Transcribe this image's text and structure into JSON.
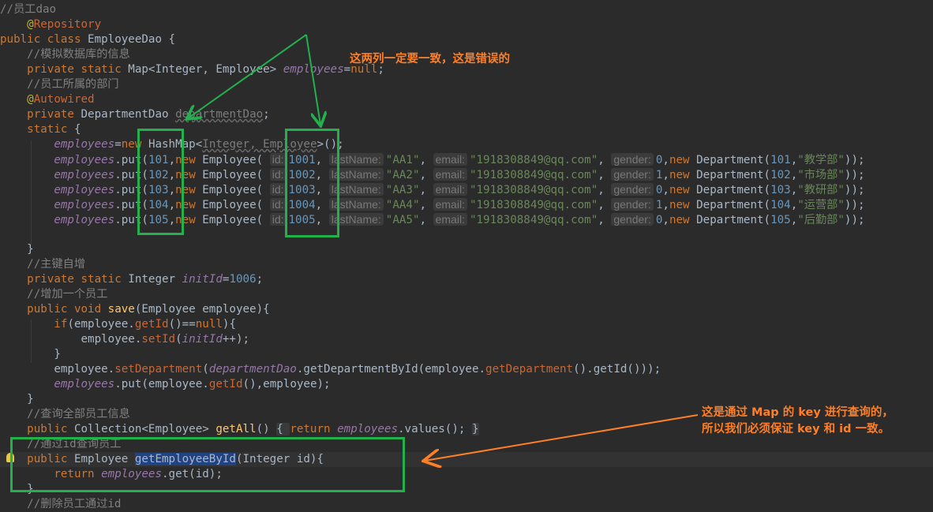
{
  "editor": {
    "lines": [
      [
        {
          "c": "cm",
          "t": "//员工dao"
        }
      ],
      [
        {
          "c": "",
          "t": "    "
        },
        {
          "c": "ann",
          "t": "@"
        },
        {
          "c": "annn",
          "t": "Repository"
        }
      ],
      [
        {
          "c": "kw",
          "t": "public class "
        },
        {
          "c": "",
          "t": "EmployeeDao {"
        }
      ],
      [
        {
          "c": "",
          "t": "    "
        },
        {
          "c": "cm",
          "t": "//模拟数据库的信息"
        }
      ],
      [
        {
          "c": "",
          "t": "    "
        },
        {
          "c": "kw",
          "t": "private static "
        },
        {
          "c": "",
          "t": "Map<Integer, Employee> "
        },
        {
          "c": "fld",
          "t": "employees"
        },
        {
          "c": "",
          "t": "="
        },
        {
          "c": "kw",
          "t": "null"
        },
        {
          "c": "",
          "t": ";"
        }
      ],
      [
        {
          "c": "",
          "t": "    "
        },
        {
          "c": "cm",
          "t": "//员工所属的部门"
        }
      ],
      [
        {
          "c": "",
          "t": "    "
        },
        {
          "c": "ann",
          "t": "@"
        },
        {
          "c": "annn",
          "t": "Autowired"
        }
      ],
      [
        {
          "c": "",
          "t": "    "
        },
        {
          "c": "kw",
          "t": "private "
        },
        {
          "c": "",
          "t": "DepartmentDao "
        },
        {
          "c": "unused",
          "t": "departmentDao"
        },
        {
          "c": "",
          "t": ";"
        }
      ],
      [
        {
          "c": "",
          "t": "    "
        },
        {
          "c": "kw",
          "t": "static "
        },
        {
          "c": "",
          "t": "{"
        }
      ],
      [
        {
          "c": "",
          "t": "        "
        },
        {
          "c": "fld",
          "t": "employees"
        },
        {
          "c": "",
          "t": "="
        },
        {
          "c": "kw",
          "t": "new "
        },
        {
          "c": "",
          "t": "HashMap<"
        },
        {
          "c": "unused",
          "t": "Integer, Employee"
        },
        {
          "c": "",
          "t": ">();"
        }
      ],
      [
        {
          "c": "",
          "t": "        "
        },
        {
          "c": "fld",
          "t": "employees"
        },
        {
          "c": "",
          "t": ".put("
        },
        {
          "c": "num",
          "t": "101"
        },
        {
          "c": "",
          "t": ","
        },
        {
          "c": "kw",
          "t": "new "
        },
        {
          "c": "",
          "t": "Employee( "
        },
        {
          "c": "hint",
          "t": "id:"
        },
        {
          "c": "num",
          "t": "1001"
        },
        {
          "c": "",
          "t": ", "
        },
        {
          "c": "hint",
          "t": "lastName:"
        },
        {
          "c": "str",
          "t": "\"AA1\""
        },
        {
          "c": "",
          "t": ", "
        },
        {
          "c": "hint",
          "t": "email:"
        },
        {
          "c": "str",
          "t": "\"1918308849@qq.com\""
        },
        {
          "c": "",
          "t": ", "
        },
        {
          "c": "hint",
          "t": "gender:"
        },
        {
          "c": "num",
          "t": "0"
        },
        {
          "c": "",
          "t": ","
        },
        {
          "c": "kw",
          "t": "new "
        },
        {
          "c": "",
          "t": "Department("
        },
        {
          "c": "num",
          "t": "101"
        },
        {
          "c": "",
          "t": ","
        },
        {
          "c": "str",
          "t": "\"教学部\""
        },
        {
          "c": "",
          "t": "));"
        }
      ],
      [
        {
          "c": "",
          "t": "        "
        },
        {
          "c": "fld",
          "t": "employees"
        },
        {
          "c": "",
          "t": ".put("
        },
        {
          "c": "num",
          "t": "102"
        },
        {
          "c": "",
          "t": ","
        },
        {
          "c": "kw",
          "t": "new "
        },
        {
          "c": "",
          "t": "Employee( "
        },
        {
          "c": "hint",
          "t": "id:"
        },
        {
          "c": "num",
          "t": "1002"
        },
        {
          "c": "",
          "t": ", "
        },
        {
          "c": "hint",
          "t": "lastName:"
        },
        {
          "c": "str",
          "t": "\"AA2\""
        },
        {
          "c": "",
          "t": ", "
        },
        {
          "c": "hint",
          "t": "email:"
        },
        {
          "c": "str",
          "t": "\"1918308849@qq.com\""
        },
        {
          "c": "",
          "t": ", "
        },
        {
          "c": "hint",
          "t": "gender:"
        },
        {
          "c": "num",
          "t": "1"
        },
        {
          "c": "",
          "t": ","
        },
        {
          "c": "kw",
          "t": "new "
        },
        {
          "c": "",
          "t": "Department("
        },
        {
          "c": "num",
          "t": "102"
        },
        {
          "c": "",
          "t": ","
        },
        {
          "c": "str",
          "t": "\"市场部\""
        },
        {
          "c": "",
          "t": "));"
        }
      ],
      [
        {
          "c": "",
          "t": "        "
        },
        {
          "c": "fld",
          "t": "employees"
        },
        {
          "c": "",
          "t": ".put("
        },
        {
          "c": "num",
          "t": "103"
        },
        {
          "c": "",
          "t": ","
        },
        {
          "c": "kw",
          "t": "new "
        },
        {
          "c": "",
          "t": "Employee( "
        },
        {
          "c": "hint",
          "t": "id:"
        },
        {
          "c": "num",
          "t": "1003"
        },
        {
          "c": "",
          "t": ", "
        },
        {
          "c": "hint",
          "t": "lastName:"
        },
        {
          "c": "str",
          "t": "\"AA3\""
        },
        {
          "c": "",
          "t": ", "
        },
        {
          "c": "hint",
          "t": "email:"
        },
        {
          "c": "str",
          "t": "\"1918308849@qq.com\""
        },
        {
          "c": "",
          "t": ", "
        },
        {
          "c": "hint",
          "t": "gender:"
        },
        {
          "c": "num",
          "t": "0"
        },
        {
          "c": "",
          "t": ","
        },
        {
          "c": "kw",
          "t": "new "
        },
        {
          "c": "",
          "t": "Department("
        },
        {
          "c": "num",
          "t": "103"
        },
        {
          "c": "",
          "t": ","
        },
        {
          "c": "str",
          "t": "\"教研部\""
        },
        {
          "c": "",
          "t": "));"
        }
      ],
      [
        {
          "c": "",
          "t": "        "
        },
        {
          "c": "fld",
          "t": "employees"
        },
        {
          "c": "",
          "t": ".put("
        },
        {
          "c": "num",
          "t": "104"
        },
        {
          "c": "",
          "t": ","
        },
        {
          "c": "kw",
          "t": "new "
        },
        {
          "c": "",
          "t": "Employee( "
        },
        {
          "c": "hint",
          "t": "id:"
        },
        {
          "c": "num",
          "t": "1004"
        },
        {
          "c": "",
          "t": ", "
        },
        {
          "c": "hint",
          "t": "lastName:"
        },
        {
          "c": "str",
          "t": "\"AA4\""
        },
        {
          "c": "",
          "t": ", "
        },
        {
          "c": "hint",
          "t": "email:"
        },
        {
          "c": "str",
          "t": "\"1918308849@qq.com\""
        },
        {
          "c": "",
          "t": ", "
        },
        {
          "c": "hint",
          "t": "gender:"
        },
        {
          "c": "num",
          "t": "1"
        },
        {
          "c": "",
          "t": ","
        },
        {
          "c": "kw",
          "t": "new "
        },
        {
          "c": "",
          "t": "Department("
        },
        {
          "c": "num",
          "t": "104"
        },
        {
          "c": "",
          "t": ","
        },
        {
          "c": "str",
          "t": "\"运营部\""
        },
        {
          "c": "",
          "t": "));"
        }
      ],
      [
        {
          "c": "",
          "t": "        "
        },
        {
          "c": "fld",
          "t": "employees"
        },
        {
          "c": "",
          "t": ".put("
        },
        {
          "c": "num",
          "t": "105"
        },
        {
          "c": "",
          "t": ","
        },
        {
          "c": "kw",
          "t": "new "
        },
        {
          "c": "",
          "t": "Employee( "
        },
        {
          "c": "hint",
          "t": "id:"
        },
        {
          "c": "num",
          "t": "1005"
        },
        {
          "c": "",
          "t": ", "
        },
        {
          "c": "hint",
          "t": "lastName:"
        },
        {
          "c": "str",
          "t": "\"AA5\""
        },
        {
          "c": "",
          "t": ", "
        },
        {
          "c": "hint",
          "t": "email:"
        },
        {
          "c": "str",
          "t": "\"1918308849@qq.com\""
        },
        {
          "c": "",
          "t": ", "
        },
        {
          "c": "hint",
          "t": "gender:"
        },
        {
          "c": "num",
          "t": "0"
        },
        {
          "c": "",
          "t": ","
        },
        {
          "c": "kw",
          "t": "new "
        },
        {
          "c": "",
          "t": "Department("
        },
        {
          "c": "num",
          "t": "105"
        },
        {
          "c": "",
          "t": ","
        },
        {
          "c": "str",
          "t": "\"后勤部\""
        },
        {
          "c": "",
          "t": "));"
        }
      ],
      [
        {
          "c": "",
          "t": ""
        }
      ],
      [
        {
          "c": "",
          "t": "    }"
        }
      ],
      [
        {
          "c": "",
          "t": "    "
        },
        {
          "c": "cm",
          "t": "//主键自增"
        }
      ],
      [
        {
          "c": "",
          "t": "    "
        },
        {
          "c": "kw",
          "t": "private static "
        },
        {
          "c": "",
          "t": "Integer "
        },
        {
          "c": "fld",
          "t": "initId"
        },
        {
          "c": "",
          "t": "="
        },
        {
          "c": "num",
          "t": "1006"
        },
        {
          "c": "",
          "t": ";"
        }
      ],
      [
        {
          "c": "",
          "t": "    "
        },
        {
          "c": "cm",
          "t": "//增加一个员工"
        }
      ],
      [
        {
          "c": "",
          "t": "    "
        },
        {
          "c": "kw",
          "t": "public void "
        },
        {
          "c": "meth",
          "t": "save"
        },
        {
          "c": "",
          "t": "(Employee employee){"
        }
      ],
      [
        {
          "c": "",
          "t": "        "
        },
        {
          "c": "kw",
          "t": "if"
        },
        {
          "c": "",
          "t": "(employee."
        },
        {
          "c": "mcolor",
          "t": "getId"
        },
        {
          "c": "",
          "t": "()=="
        },
        {
          "c": "kw",
          "t": "null"
        },
        {
          "c": "",
          "t": "){"
        }
      ],
      [
        {
          "c": "",
          "t": "            employee."
        },
        {
          "c": "mcolor",
          "t": "setId"
        },
        {
          "c": "",
          "t": "("
        },
        {
          "c": "fld",
          "t": "initId"
        },
        {
          "c": "",
          "t": "++);"
        }
      ],
      [
        {
          "c": "",
          "t": "        }"
        }
      ],
      [
        {
          "c": "",
          "t": "        employee."
        },
        {
          "c": "mcolor",
          "t": "setDepartment"
        },
        {
          "c": "",
          "t": "("
        },
        {
          "c": "fld",
          "t": "departmentDao"
        },
        {
          "c": "",
          "t": ".getDepartmentById(employee."
        },
        {
          "c": "mcolor",
          "t": "getDepartment"
        },
        {
          "c": "",
          "t": "().getId()));"
        }
      ],
      [
        {
          "c": "",
          "t": "        "
        },
        {
          "c": "fld",
          "t": "employees"
        },
        {
          "c": "",
          "t": ".put(employee."
        },
        {
          "c": "mcolor",
          "t": "getId"
        },
        {
          "c": "",
          "t": "(),employee);"
        }
      ],
      [
        {
          "c": "",
          "t": "    }"
        }
      ],
      [
        {
          "c": "",
          "t": "    "
        },
        {
          "c": "cm",
          "t": "//查询全部员工信息"
        }
      ],
      [
        {
          "c": "",
          "t": "    "
        },
        {
          "c": "kw",
          "t": "public "
        },
        {
          "c": "",
          "t": "Collection<Employee> "
        },
        {
          "c": "meth",
          "t": "getAll"
        },
        {
          "c": "",
          "t": "() "
        },
        {
          "c": "fold",
          "t": "{ "
        },
        {
          "c": "kw",
          "t": "return "
        },
        {
          "c": "fld",
          "t": "employees"
        },
        {
          "c": "",
          "t": ".values(); "
        },
        {
          "c": "fold",
          "t": "}"
        }
      ],
      [
        {
          "c": "",
          "t": "    "
        },
        {
          "c": "cm",
          "t": "//通过id查询员工"
        }
      ],
      [
        {
          "c": "",
          "t": "    "
        },
        {
          "c": "kw",
          "t": "public "
        },
        {
          "c": "",
          "t": "Employee "
        },
        {
          "c": "sel",
          "t": "getEmployeeById"
        },
        {
          "c": "",
          "t": "(Integer id){"
        }
      ],
      [
        {
          "c": "",
          "t": "        "
        },
        {
          "c": "kw",
          "t": "return "
        },
        {
          "c": "fld",
          "t": "employees"
        },
        {
          "c": "",
          "t": ".get(id);"
        }
      ],
      [
        {
          "c": "",
          "t": "    }"
        }
      ],
      [
        {
          "c": "",
          "t": "    "
        },
        {
          "c": "cm",
          "t": "//删除员工通过id"
        }
      ]
    ]
  },
  "annotations": {
    "note_top": "这两列一定要一致，这是错误的",
    "note_bottom_1": "这是通过 Map 的 key 进行查询的，",
    "note_bottom_2": "所以我们必须保证 key 和  id 一致。",
    "green": "#22b14c",
    "orange": "#ff7f27"
  }
}
